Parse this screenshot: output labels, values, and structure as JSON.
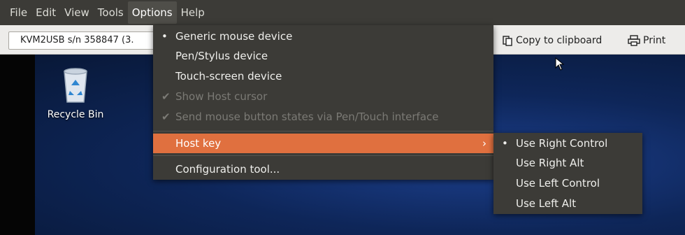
{
  "menubar": {
    "items": [
      "File",
      "Edit",
      "View",
      "Tools",
      "Options",
      "Help"
    ]
  },
  "toolbar": {
    "device": "KVM2USB s/n 358847 (3.",
    "copy_label": "Copy to clipboard",
    "print_label": "Print"
  },
  "desktop": {
    "recycle_bin_label": "Recycle Bin"
  },
  "options_menu": {
    "generic_mouse": "Generic mouse device",
    "pen_stylus": "Pen/Stylus device",
    "touch_screen": "Touch-screen device",
    "show_host_cursor": "Show Host cursor",
    "send_mouse_states": "Send mouse button states via Pen/Touch interface",
    "host_key": "Host key",
    "configuration_tool": "Configuration tool..."
  },
  "hostkey_menu": {
    "items": [
      "Use Right Control",
      "Use Right Alt",
      "Use Left Control",
      "Use Left Alt"
    ]
  },
  "glyphs": {
    "bullet": "•",
    "check": "✔",
    "arrow": "›"
  }
}
